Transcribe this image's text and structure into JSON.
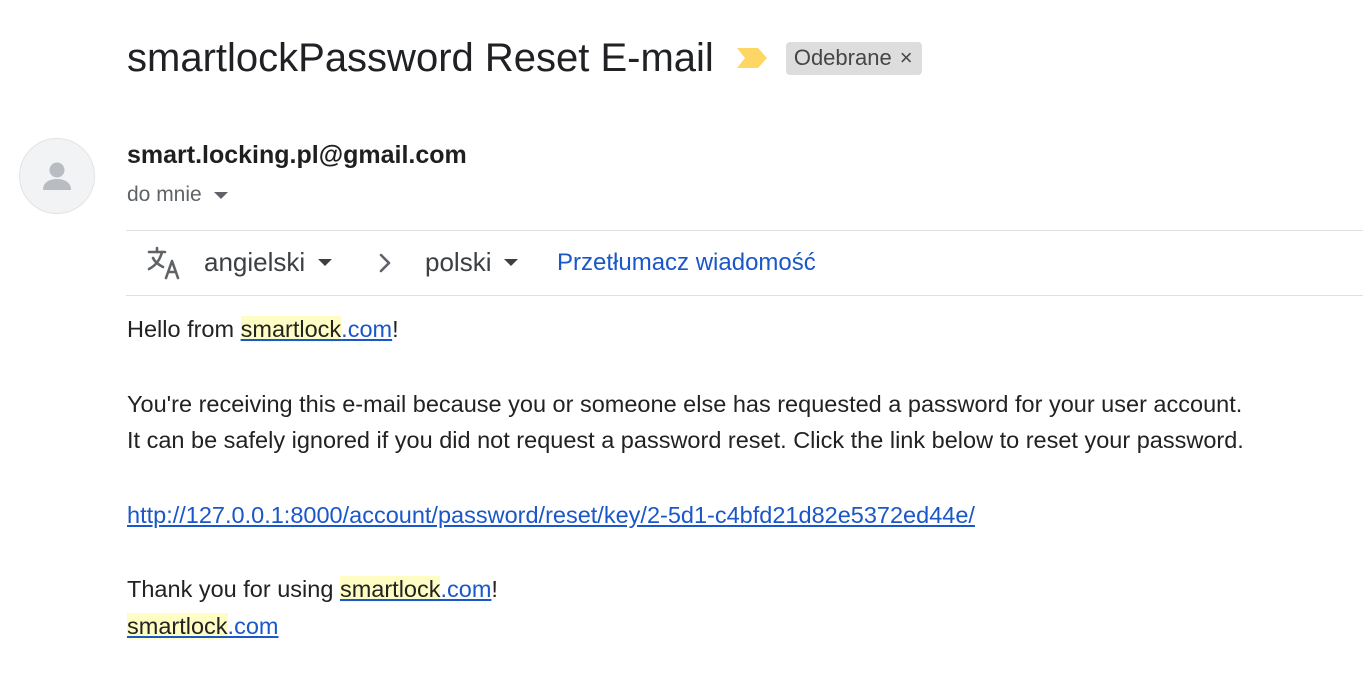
{
  "subject": "smartlockPassword Reset E-mail",
  "label": {
    "text": "Odebrane",
    "remove": "×"
  },
  "sender": "smart.locking.pl@gmail.com",
  "recipient": "do mnie",
  "translate": {
    "from_lang": "angielski",
    "to_lang": "polski",
    "action": "Przetłumacz wiadomość"
  },
  "body": {
    "greeting_prefix": "Hello from ",
    "brand": "smartlock",
    "domain_suffix": ".com",
    "exclaim": "!",
    "line1": "You're receiving this e-mail because you or someone else has requested a password for your user account.",
    "line2": "It can be safely ignored if you did not request a password reset. Click the link below to reset your password.",
    "reset_link": "http://127.0.0.1:8000/account/password/reset/key/2-5d1-c4bfd21d82e5372ed44e/",
    "thanks_prefix": "Thank you for using "
  },
  "colors": {
    "link": "#1a57c8",
    "highlight": "#fdfdc4",
    "importance_marker": "#fdd663",
    "label_chip": "#dddddd"
  },
  "icons": {
    "importance": "importance-marker-icon",
    "avatar": "person-icon",
    "translate": "translate-icon",
    "arrow": "chevron-right-icon"
  }
}
